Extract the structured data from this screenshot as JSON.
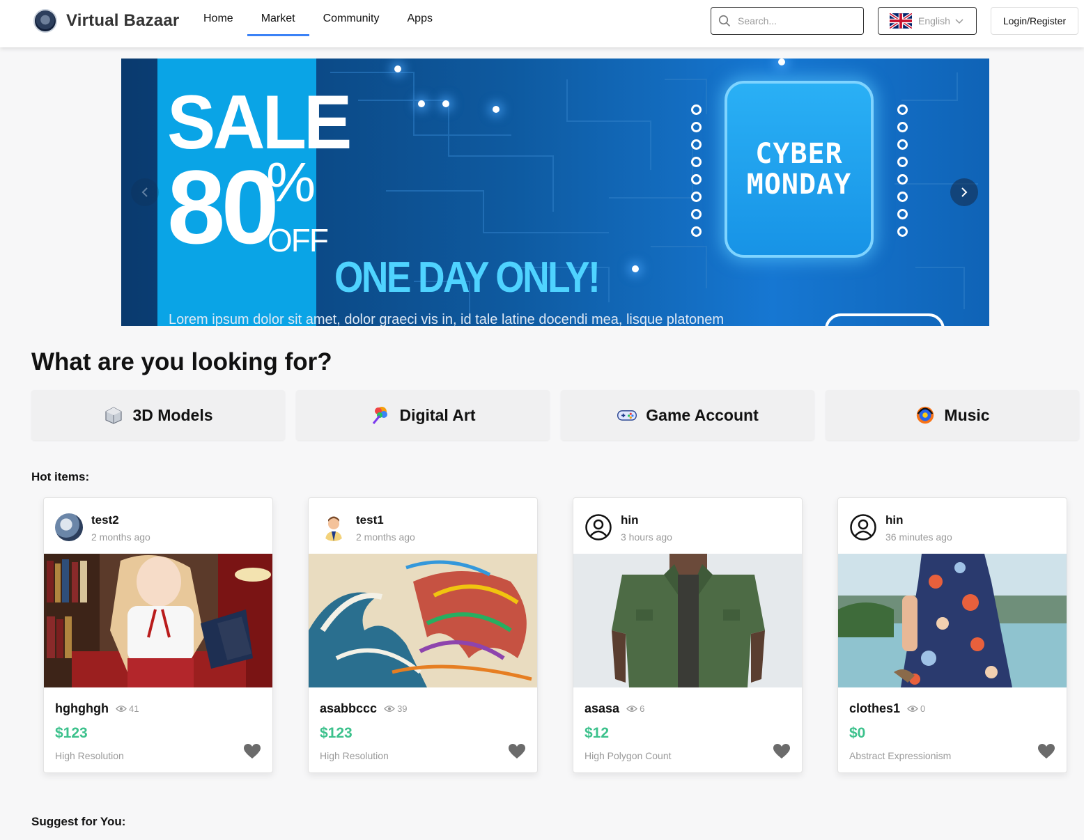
{
  "header": {
    "brand": "Virtual Bazaar",
    "nav": [
      "Home",
      "Market",
      "Community",
      "Apps"
    ],
    "active_nav": "Market",
    "search_placeholder": "Search...",
    "language": "English",
    "login_label": "Login/Register"
  },
  "banner": {
    "sale": "SALE",
    "percent": "80",
    "percent_symbol": "%",
    "off": "OFF",
    "one_day": "ONE DAY ONLY!",
    "chip_line1": "CYBER",
    "chip_line2": "MONDAY",
    "lorem": "Lorem ipsum dolor sit amet, dolor graeci vis in, id tale latine docendi mea, lisque platonem"
  },
  "looking_title": "What are you looking for?",
  "categories": [
    {
      "label": "3D Models",
      "icon": "3d-model-icon"
    },
    {
      "label": "Digital Art",
      "icon": "digital-art-icon"
    },
    {
      "label": "Game Account",
      "icon": "gamepad-icon"
    },
    {
      "label": "Music",
      "icon": "music-icon"
    }
  ],
  "hot_title": "Hot items:",
  "hot_items": [
    {
      "user": "test2",
      "time": "2 months ago",
      "avatar": "anime-avatar",
      "title": "hghghgh",
      "views": "41",
      "price": "$123",
      "tag": "High Resolution",
      "image": "anime-girl-reading"
    },
    {
      "user": "test1",
      "time": "2 months ago",
      "avatar": "businessman-avatar",
      "title": "asabbccc",
      "views": "39",
      "price": "$123",
      "tag": "High Resolution",
      "image": "great-wave-pixel-art"
    },
    {
      "user": "hin",
      "time": "3 hours ago",
      "avatar": "user-outline-avatar",
      "title": "asasa",
      "views": "6",
      "price": "$12",
      "tag": "High Polygon Count",
      "image": "green-shirt"
    },
    {
      "user": "hin",
      "time": "36 minutes ago",
      "avatar": "user-outline-avatar",
      "title": "clothes1",
      "views": "0",
      "price": "$0",
      "tag": "Abstract Expressionism",
      "image": "floral-dress"
    }
  ],
  "suggest_title": "Suggest for You:",
  "colors": {
    "accent": "#3b82f6",
    "price": "#3cc18c",
    "muted": "#9a9a9a"
  }
}
